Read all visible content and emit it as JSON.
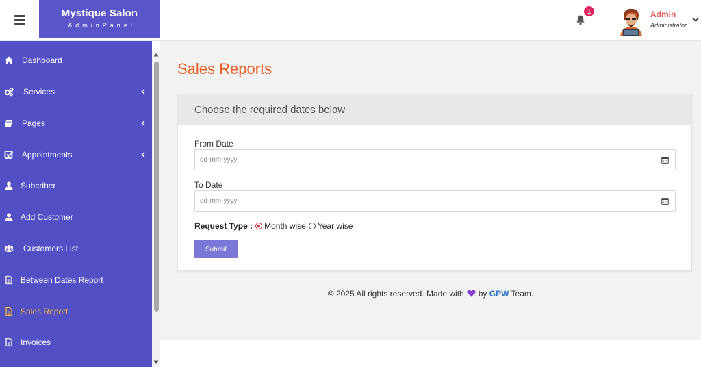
{
  "header": {
    "brand_name": "Mystique Salon",
    "brand_sub": "AdminPanel",
    "notification_count": "1",
    "user_name": "Admin",
    "user_role": "Administrator"
  },
  "sidebar": {
    "items": [
      {
        "label": "Dashboard",
        "icon": "home-icon",
        "has_caret": false,
        "active": false
      },
      {
        "label": "Services",
        "icon": "gears-icon",
        "has_caret": true,
        "active": false
      },
      {
        "label": "Pages",
        "icon": "book-icon",
        "has_caret": true,
        "active": false
      },
      {
        "label": "Appointments",
        "icon": "check-square-icon",
        "has_caret": true,
        "active": false
      },
      {
        "label": "Subcriber",
        "icon": "user-icon",
        "has_caret": false,
        "active": false
      },
      {
        "label": "Add Customer",
        "icon": "user-icon",
        "has_caret": false,
        "active": false
      },
      {
        "label": "Customers List",
        "icon": "users-icon",
        "has_caret": false,
        "active": false
      },
      {
        "label": "Between Dates Report",
        "icon": "file-icon",
        "has_caret": false,
        "active": false
      },
      {
        "label": "Sales Report",
        "icon": "file-icon",
        "has_caret": false,
        "active": true
      },
      {
        "label": "Invoices",
        "icon": "file-icon",
        "has_caret": false,
        "active": false
      }
    ]
  },
  "main": {
    "title": "Sales Reports",
    "card_title": "Choose the required dates below",
    "from_label": "From Date",
    "from_placeholder": "dd-mm-yyyy",
    "to_label": "To Date",
    "to_placeholder": "dd-mm-yyyy",
    "request_type_label": "Request Type :",
    "options": [
      {
        "label": "Month wise",
        "checked": true
      },
      {
        "label": "Year wise",
        "checked": false
      }
    ],
    "submit_label": "Submit"
  },
  "footer": {
    "text_before": "© 2025 All rights reserved. Made with",
    "text_by": "by",
    "team_name": "GPW",
    "text_after": "Team."
  },
  "colors": {
    "sidebar_bg": "#5250c4",
    "brand_bg": "#5a55c8",
    "title_accent": "#e85d22",
    "active_item": "#f1b73a",
    "badge": "#e4245e",
    "button": "#7a77d6"
  }
}
